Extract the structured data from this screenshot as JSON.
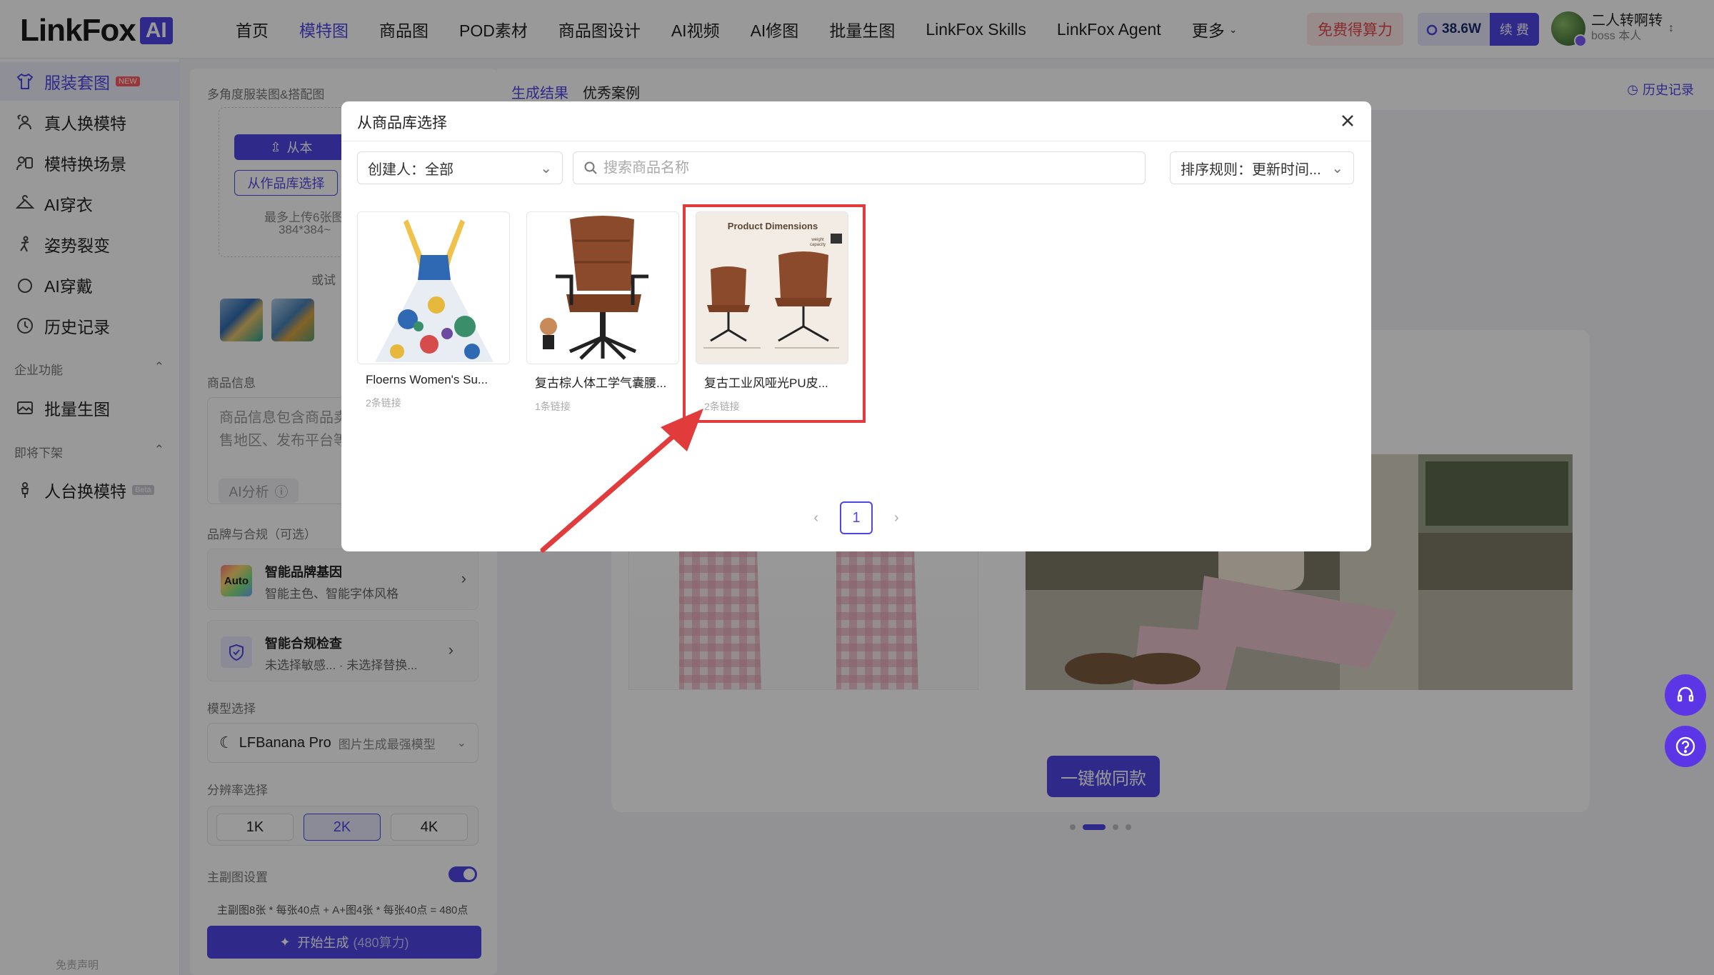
{
  "logo": {
    "text": "LinkFox",
    "badge": "AI"
  },
  "nav": [
    {
      "label": "首页"
    },
    {
      "label": "模特图",
      "active": true
    },
    {
      "label": "商品图"
    },
    {
      "label": "POD素材"
    },
    {
      "label": "商品图设计"
    },
    {
      "label": "AI视频"
    },
    {
      "label": "AI修图"
    },
    {
      "label": "批量生图"
    },
    {
      "label": "LinkFox Skills"
    },
    {
      "label": "LinkFox Agent"
    },
    {
      "label": "更多"
    }
  ],
  "header": {
    "free_points": "免费得算力",
    "points_value": "38.6W",
    "renew": "续 费",
    "user_name": "二人转啊转",
    "user_role": "boss 本人"
  },
  "sidebar": {
    "items": [
      {
        "label": "服装套图",
        "badge": "NEW",
        "active": true,
        "icon": "shirt-icon"
      },
      {
        "label": "真人换模特",
        "icon": "swap-person-icon"
      },
      {
        "label": "模特换场景",
        "icon": "scene-icon"
      },
      {
        "label": "AI穿衣",
        "icon": "hanger-icon"
      },
      {
        "label": "姿势裂变",
        "icon": "pose-icon"
      },
      {
        "label": "AI穿戴",
        "icon": "ring-icon"
      },
      {
        "label": "历史记录",
        "icon": "history-icon"
      }
    ],
    "section_enterprise": "企业功能",
    "enterprise_items": [
      {
        "label": "批量生图",
        "icon": "image-icon"
      }
    ],
    "section_soon": "即将下架",
    "soon_items": [
      {
        "label": "人台换模特",
        "badge": "Beta",
        "icon": "mannequin-icon"
      }
    ],
    "footer": "免责声明"
  },
  "form": {
    "multi_angle_label": "多角度服装图&搭配图",
    "upload_local": "从本",
    "from_library": "从作品库选择",
    "upload_tip_1": "最多上传6张图",
    "upload_tip_2": "384*384~",
    "or_label": "或试",
    "product_info_label": "商品信息",
    "product_info_placeholder_1": "商品信息包含商品卖",
    "product_info_placeholder_2": "售地区、发布平台等",
    "ai_analyze": "AI分析",
    "brand_label": "品牌与合规（可选）",
    "brand_card": {
      "badge": "Auto",
      "title": "智能品牌基因",
      "sub": "智能主色、智能字体风格"
    },
    "compliance_card": {
      "title": "智能合规检查",
      "sub": "未选择敏感...  · 未选择替换..."
    },
    "model_label": "模型选择",
    "model_name": "LFBanana Pro",
    "model_desc": "图片生成最强模型",
    "resolution_label": "分辨率选择",
    "resolutions": [
      "1K",
      "2K",
      "4K"
    ],
    "resolution_selected": "2K",
    "main_image_label": "主副图设置",
    "main_image_enabled": true,
    "cost_text": "主副图8张 * 每张40点 + A+图4张 * 每张40点 = 480点",
    "generate_label": "开始生成",
    "generate_cost": "(480算力)"
  },
  "main": {
    "tabs": [
      {
        "label": "生成结果",
        "active": true
      },
      {
        "label": "优秀案例"
      }
    ],
    "history_link": "历史记录",
    "same_style_button": "一键做同款",
    "carousel_index": 2,
    "carousel_total": 4
  },
  "modal": {
    "title": "从商品库选择",
    "creator_label": "创建人：全部",
    "search_placeholder": "搜索商品名称",
    "sort_label": "排序规则：更新时间...",
    "products": [
      {
        "name": "Floerns Women's Su...",
        "links": "2条链接"
      },
      {
        "name": "复古棕人体工学气囊腰...",
        "links": "1条链接"
      },
      {
        "name": "复古工业风哑光PU皮...",
        "links": "2条链接",
        "highlighted": true,
        "image_caption": "Product Dimensions",
        "image_note": "weight capacity"
      }
    ],
    "page": "1"
  },
  "colors": {
    "accent": "#4f46e5",
    "highlight": "#e23b3b",
    "free_bg": "#fde8e8"
  }
}
